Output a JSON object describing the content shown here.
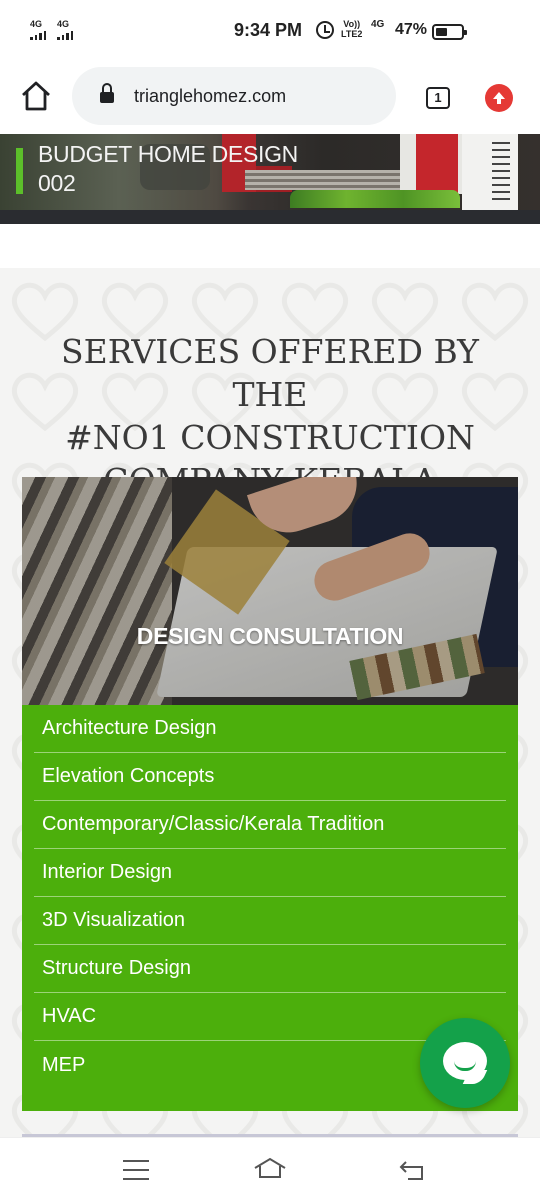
{
  "status_bar": {
    "sim1": "4G",
    "sim2": "4G",
    "time": "9:34 PM",
    "volte_top": "Vo))",
    "volte_bottom": "LTE2",
    "network": "4G",
    "battery": "47%",
    "battery_level": 0.47,
    "icons": [
      "signal-icon",
      "alarm-icon",
      "battery-icon"
    ]
  },
  "browser": {
    "url": "trianglehomez.com",
    "tab_count": "1",
    "icons": [
      "home-icon",
      "lock-icon",
      "tabs-icon",
      "update-icon"
    ],
    "update_color": "#e53935"
  },
  "hero": {
    "title_line1": "BUDGET HOME DESIGN",
    "title_line2": "002",
    "accent_color": "#5cbf2a"
  },
  "services": {
    "heading_line1": "SERVICES OFFERED BY THE",
    "heading_line2": "#NO1 CONSTRUCTION",
    "heading_line3": "COMPANY KERALA",
    "card": {
      "title": "DESIGN CONSULTATION",
      "list_color": "#4caf0c",
      "items": [
        "Architecture Design",
        "Elevation Concepts",
        "Contemporary/Classic/Kerala Tradition",
        "Interior Design",
        "3D Visualization",
        "Structure Design",
        "HVAC",
        "MEP"
      ]
    }
  },
  "chat": {
    "icon": "chat-icon",
    "color": "#14a14a"
  },
  "nav": {
    "icons": [
      "recents-icon",
      "home-icon",
      "back-icon"
    ]
  }
}
